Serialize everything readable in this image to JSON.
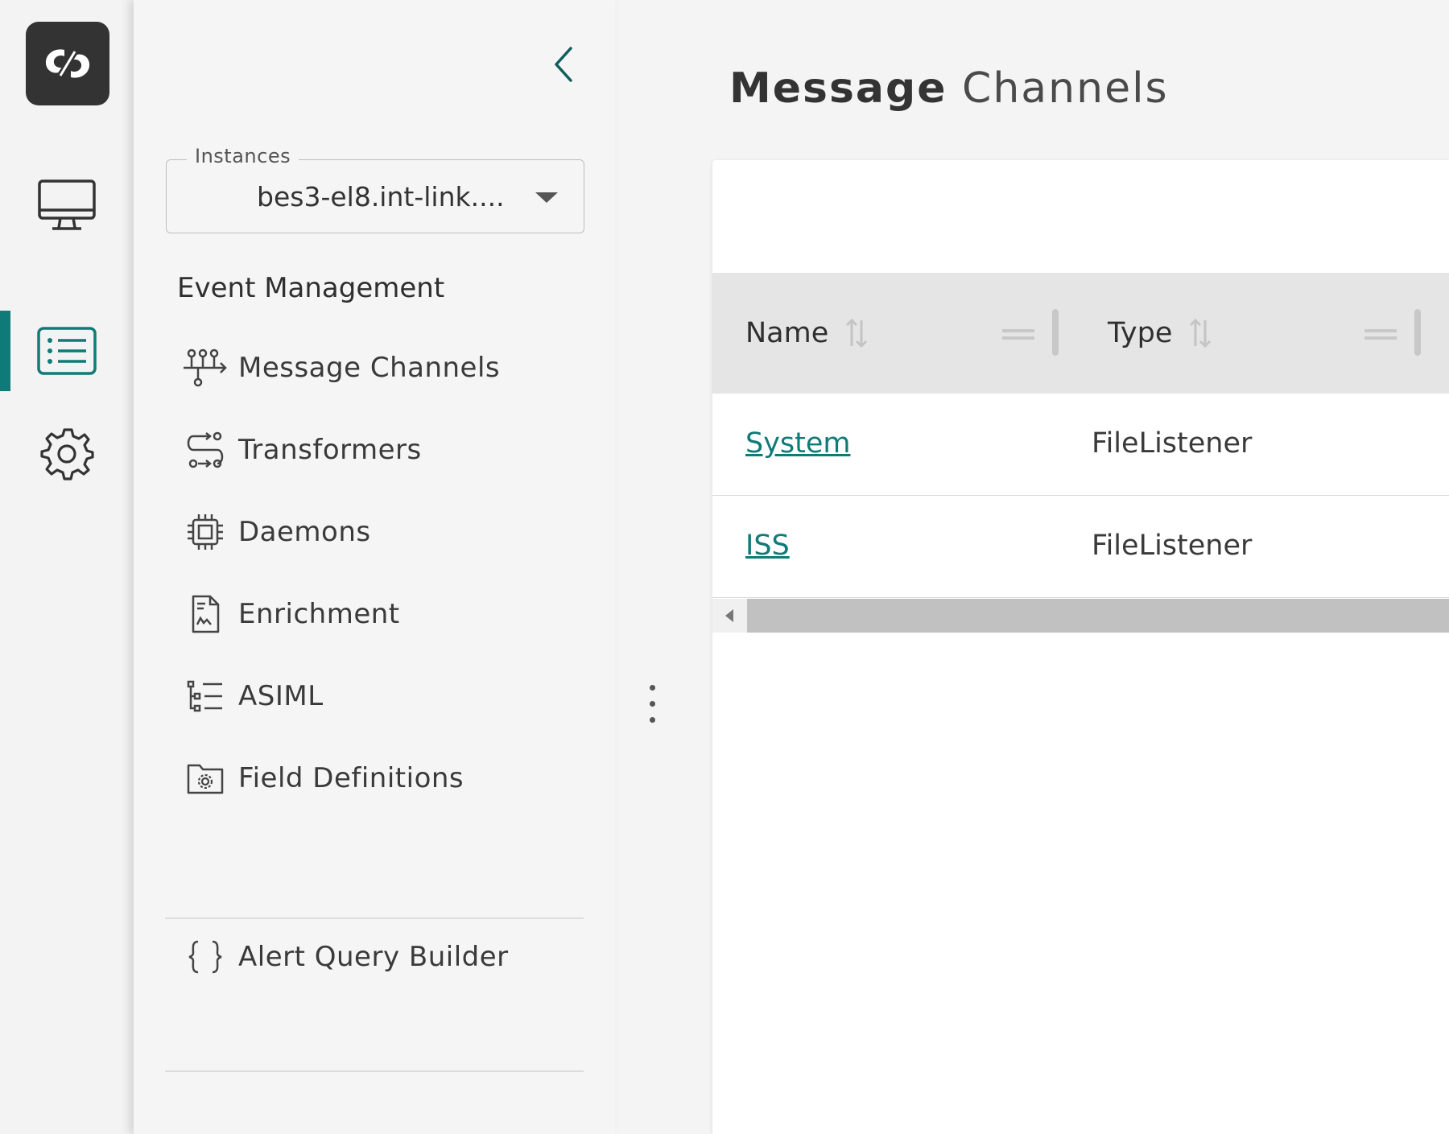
{
  "rail": {
    "items": [
      {
        "icon": "monitor-icon",
        "active": false
      },
      {
        "icon": "list-icon",
        "active": true
      },
      {
        "icon": "gear-icon",
        "active": false
      }
    ]
  },
  "panel": {
    "instances_label": "Instances",
    "instance_value": "bes3-el8.int-link....",
    "section_title": "Event Management",
    "items": [
      {
        "label": "Message Channels",
        "icon": "channels-icon"
      },
      {
        "label": "Transformers",
        "icon": "transformers-icon"
      },
      {
        "label": "Daemons",
        "icon": "chip-icon"
      },
      {
        "label": "Enrichment",
        "icon": "document-icon"
      },
      {
        "label": "ASIML",
        "icon": "tree-list-icon"
      },
      {
        "label": "Field Definitions",
        "icon": "folder-gear-icon"
      }
    ],
    "extra_items": [
      {
        "label": "Alert Query Builder",
        "icon": "braces-icon"
      }
    ]
  },
  "main": {
    "title_bold": "Message",
    "title_rest": "Channels",
    "table": {
      "columns": [
        "Name",
        "Type"
      ],
      "rows": [
        {
          "name": "System",
          "type": "FileListener"
        },
        {
          "name": "ISS",
          "type": "FileListener"
        }
      ]
    }
  },
  "colors": {
    "accent": "#0f7b78",
    "logo_bg": "#333333"
  }
}
